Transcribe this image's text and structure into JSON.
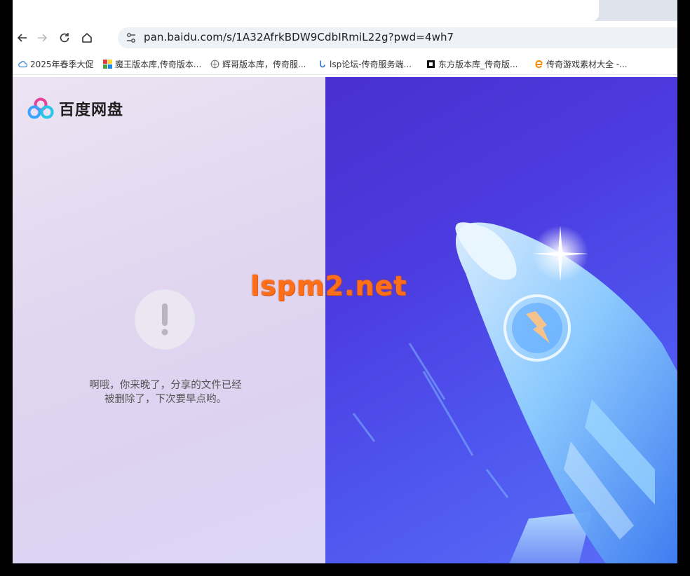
{
  "browser": {
    "url": "pan.baidu.com/s/1A32AfrkBDW9CdbIRmiL22g?pwd=4wh7",
    "bookmarks": [
      {
        "label": "2025年春季大促",
        "icon": "cloud-icon"
      },
      {
        "label": "魔王版本库,传奇版本...",
        "icon": "colorful-squares-icon"
      },
      {
        "label": "辉哥版本库，传奇服...",
        "icon": "globe-icon"
      },
      {
        "label": "lsp论坛-传奇服务端...",
        "icon": "blue-swirl-icon"
      },
      {
        "label": "东方版本库_传奇版...",
        "icon": "black-square-icon"
      },
      {
        "label": "传奇游戏素材大全 -...",
        "icon": "orange-e-icon"
      }
    ]
  },
  "page": {
    "brand": "百度网盘",
    "message_line1": "啊哦，你来晚了，分享的文件已经",
    "message_line2": "被删除了，下次要早点哟。",
    "watermark": "lspm2.net"
  },
  "colors": {
    "left_panel": "#e2d7f0",
    "right_panel": "#4c3ce0",
    "watermark": "#ff6f1a"
  }
}
